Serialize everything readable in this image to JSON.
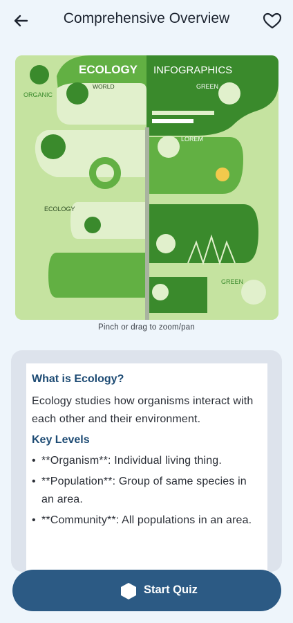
{
  "appbar": {
    "title": "Comprehensive Overview",
    "back_icon": "arrow-left-icon",
    "favorite_icon": "heart-outline-icon"
  },
  "infographic": {
    "left_title": "ECOLOGY",
    "right_title": "INFOGRAPHICS",
    "organic": "ORGANIC",
    "world": "WORLD",
    "green_top": "GREEN",
    "lorem": "LOREM",
    "ecology_small": "ECOLOGY",
    "green_bottom": "GREEN",
    "colors": {
      "dark_green": "#3a8a2c",
      "mid_green": "#62b043",
      "light_green": "#c5e3a0",
      "pale_green": "#e1f0cc"
    }
  },
  "hint": "Pinch or drag to zoom/pan",
  "card": {
    "heading1": "What is Ecology?",
    "para1": "Ecology studies how organisms interact with each other and their environment.",
    "heading2": "Key Levels",
    "bullets": [
      "**Organism**: Individual living thing.",
      "**Population**: Group of same species in an area.",
      "**Community**: All populations in an area."
    ]
  },
  "quiz_button": {
    "label": "Start Quiz",
    "icon": "hexagon-icon"
  }
}
